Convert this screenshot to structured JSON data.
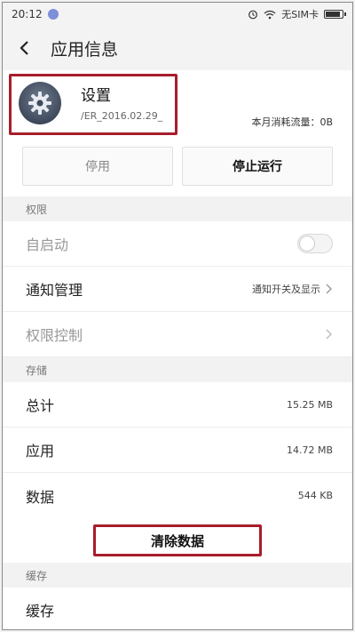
{
  "status": {
    "time": "20:12",
    "sim": "无SIM卡"
  },
  "appbar": {
    "title": "应用信息"
  },
  "app": {
    "name": "设置",
    "version": "/ER_2016.02.29_",
    "traffic": "本月消耗流量：0B"
  },
  "buttons": {
    "disable": "停用",
    "force_stop": "停止运行"
  },
  "permissions": {
    "header": "权限",
    "autostart": "自启动",
    "notification": "通知管理",
    "notification_value": "通知开关及显示",
    "permission_control": "权限控制"
  },
  "storage": {
    "header": "存储",
    "total_label": "总计",
    "total_value": "15.25 MB",
    "app_label": "应用",
    "app_value": "14.72 MB",
    "data_label": "数据",
    "data_value": "544 KB",
    "clear_button": "清除数据"
  },
  "cache": {
    "header": "缓存",
    "label": "缓存"
  },
  "colors": {
    "highlight": "#a81d2b",
    "background": "#f2f2f2"
  }
}
